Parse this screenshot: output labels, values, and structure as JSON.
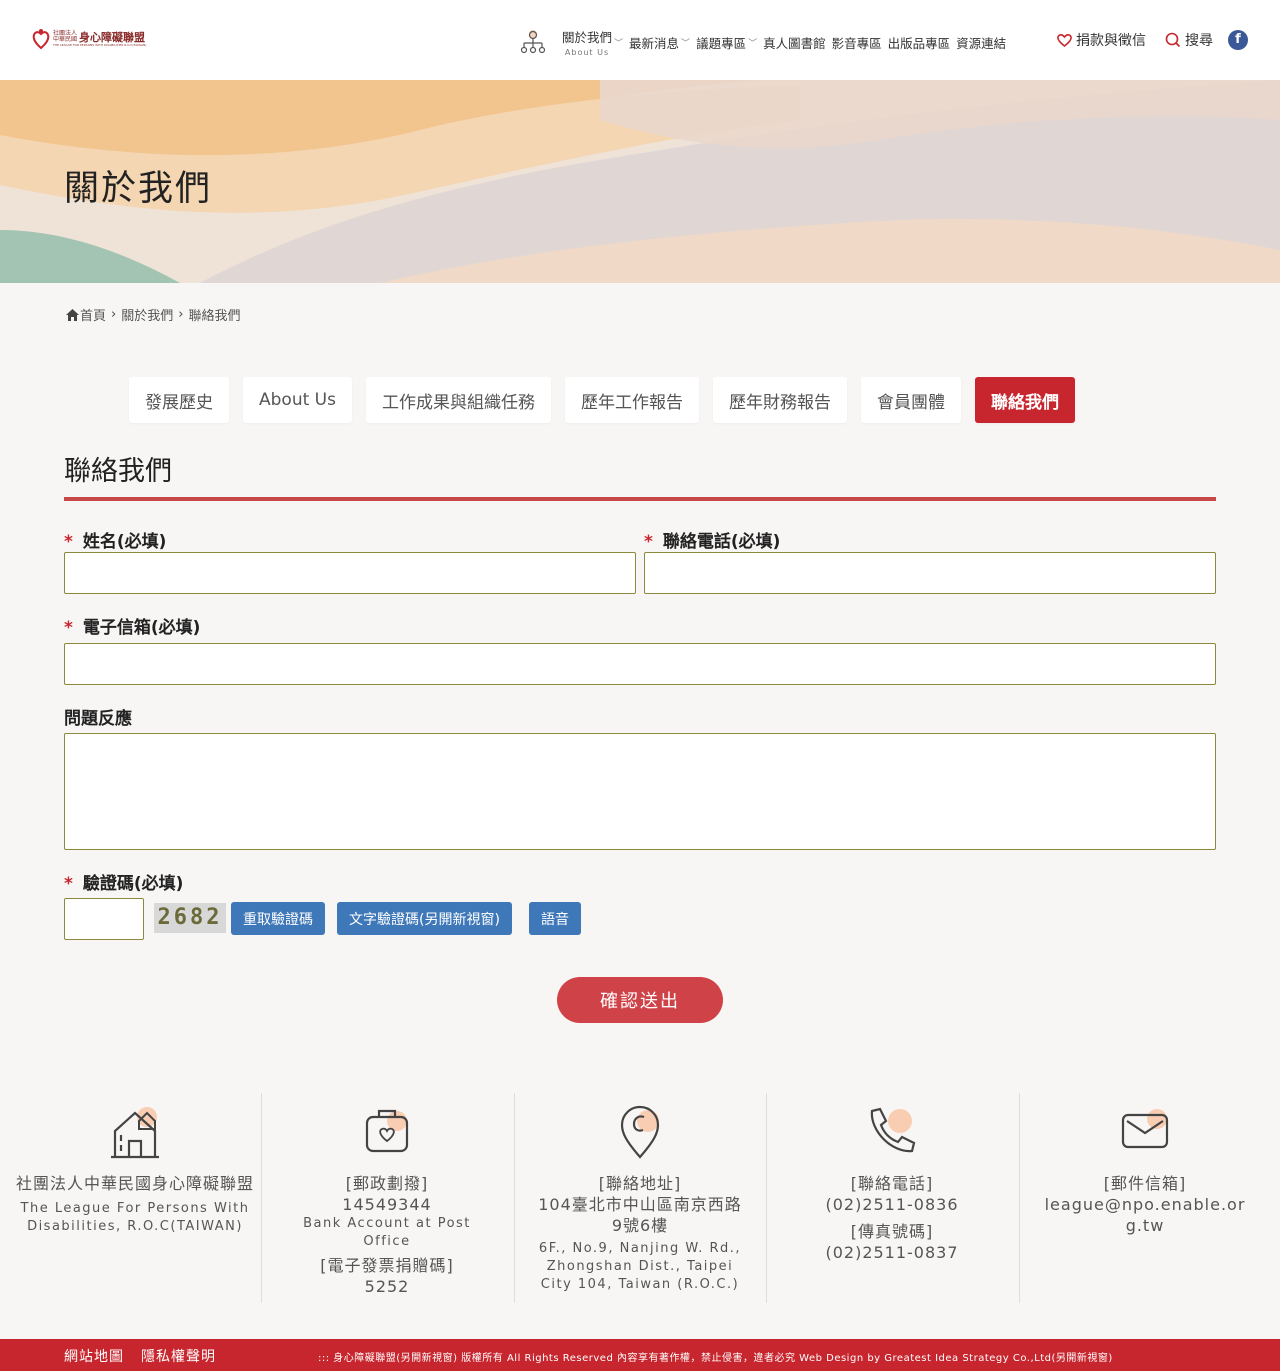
{
  "header": {
    "logo_small1": "社團法人",
    "logo_small2": "中華民國",
    "logo_big": "身心障礙聯盟",
    "logo_en": "THE LEAGUE FOR PERSONS WITH DISABILITIES R.O.C(TAIWAN)",
    "nav": [
      {
        "label": "關於我們",
        "sub": "About Us",
        "has_dropdown": true
      },
      {
        "label": "最新消息",
        "has_dropdown": true
      },
      {
        "label": "議題專區",
        "has_dropdown": true
      },
      {
        "label": "真人圖書館"
      },
      {
        "label": "影音專區"
      },
      {
        "label": "出版品專區"
      },
      {
        "label": "資源連結"
      }
    ],
    "donate": "捐款與徵信",
    "search": "搜尋",
    "facebook": "f"
  },
  "banner": {
    "title": "關於我們"
  },
  "breadcrumb": [
    "首頁",
    "關於我們",
    "聯絡我們"
  ],
  "tabs": [
    {
      "label": "發展歷史",
      "active": false
    },
    {
      "label": "About Us",
      "active": false
    },
    {
      "label": "工作成果與組織任務",
      "active": false
    },
    {
      "label": "歷年工作報告",
      "active": false
    },
    {
      "label": "歷年財務報告",
      "active": false
    },
    {
      "label": "會員團體",
      "active": false
    },
    {
      "label": "聯絡我們",
      "active": true
    }
  ],
  "section_title": "聯絡我們",
  "form": {
    "name_label": "姓名(必填)",
    "phone_label": "聯絡電話(必填)",
    "email_label": "電子信箱(必填)",
    "feedback_label": "問題反應",
    "captcha_label": "驗證碼(必填)",
    "required_mark": "*",
    "name_value": "",
    "phone_value": "",
    "email_value": "",
    "feedback_value": "",
    "captcha_value": "",
    "captcha_code": "2682",
    "refresh_captcha": "重取驗證碼",
    "text_captcha": "文字驗證碼(另開新視窗)",
    "audio_captcha": "語音",
    "submit": "確認送出"
  },
  "footer_info": {
    "org": {
      "name_zh": "社團法人中華民國身心障礙聯盟",
      "name_en": "The League For Persons With Disabilities, R.O.C(TAIWAN)"
    },
    "postal": {
      "title": "[郵政劃撥]",
      "account": "14549344",
      "account_en": "Bank Account at Post Office",
      "invoice_title": "[電子發票捐贈碼]",
      "invoice_code": "5252"
    },
    "address": {
      "title": "[聯絡地址]",
      "zh": "104臺北市中山區南京西路9號6樓",
      "en": "6F., No.9, Nanjing W. Rd., Zhongshan Dist., Taipei City 104, Taiwan (R.O.C.)"
    },
    "phone": {
      "title": "[聯絡電話]",
      "number": "(02)2511-0836",
      "fax_title": "[傳真號碼]",
      "fax": "(02)2511-0837"
    },
    "email": {
      "title": "[郵件信箱]",
      "address": "league@npo.enable.org.tw"
    }
  },
  "footer": {
    "sitemap": "網站地圖",
    "privacy": "隱私權聲明",
    "copyright": "::: 身心障礙聯盟(另開新視窗) 版權所有 All Rights Reserved 內容享有著作權，禁止侵害，違者必究 Web Design by Greatest Idea Strategy Co.,Ltd(另開新視窗)"
  },
  "colors": {
    "accent": "#c8262e",
    "button_blue": "#3f78b8",
    "submit": "#cf4247",
    "background": "#f8f6f4"
  }
}
